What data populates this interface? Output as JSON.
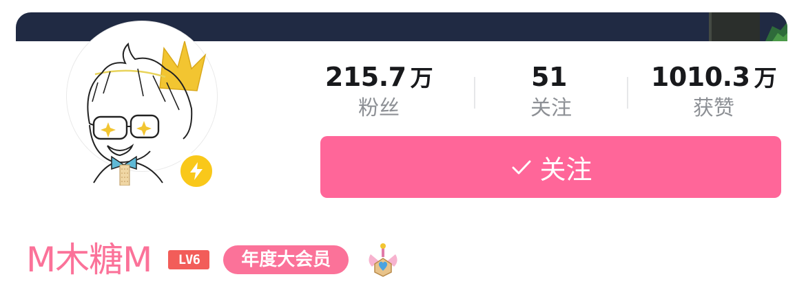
{
  "stats": [
    {
      "value": "215.7",
      "unit": "万",
      "label": "粉丝"
    },
    {
      "value": "51",
      "unit": "",
      "label": "关注"
    },
    {
      "value": "1010.3",
      "unit": "万",
      "label": "获赞"
    }
  ],
  "follow_button": {
    "label": "关注"
  },
  "profile": {
    "username": "M木糖M",
    "level_badge": "LV6",
    "vip_badge": "年度大会员"
  },
  "icons": {
    "avatar_badge": "lightning-bolt-icon",
    "follow_check": "checkmark-icon",
    "medal": "pendant-medal-icon"
  },
  "colors": {
    "brand_pink": "#fb7299",
    "button_pink": "#ff6699",
    "level_red": "#f25d59",
    "badge_yellow": "#f9c81a",
    "banner_navy": "#202a43"
  }
}
